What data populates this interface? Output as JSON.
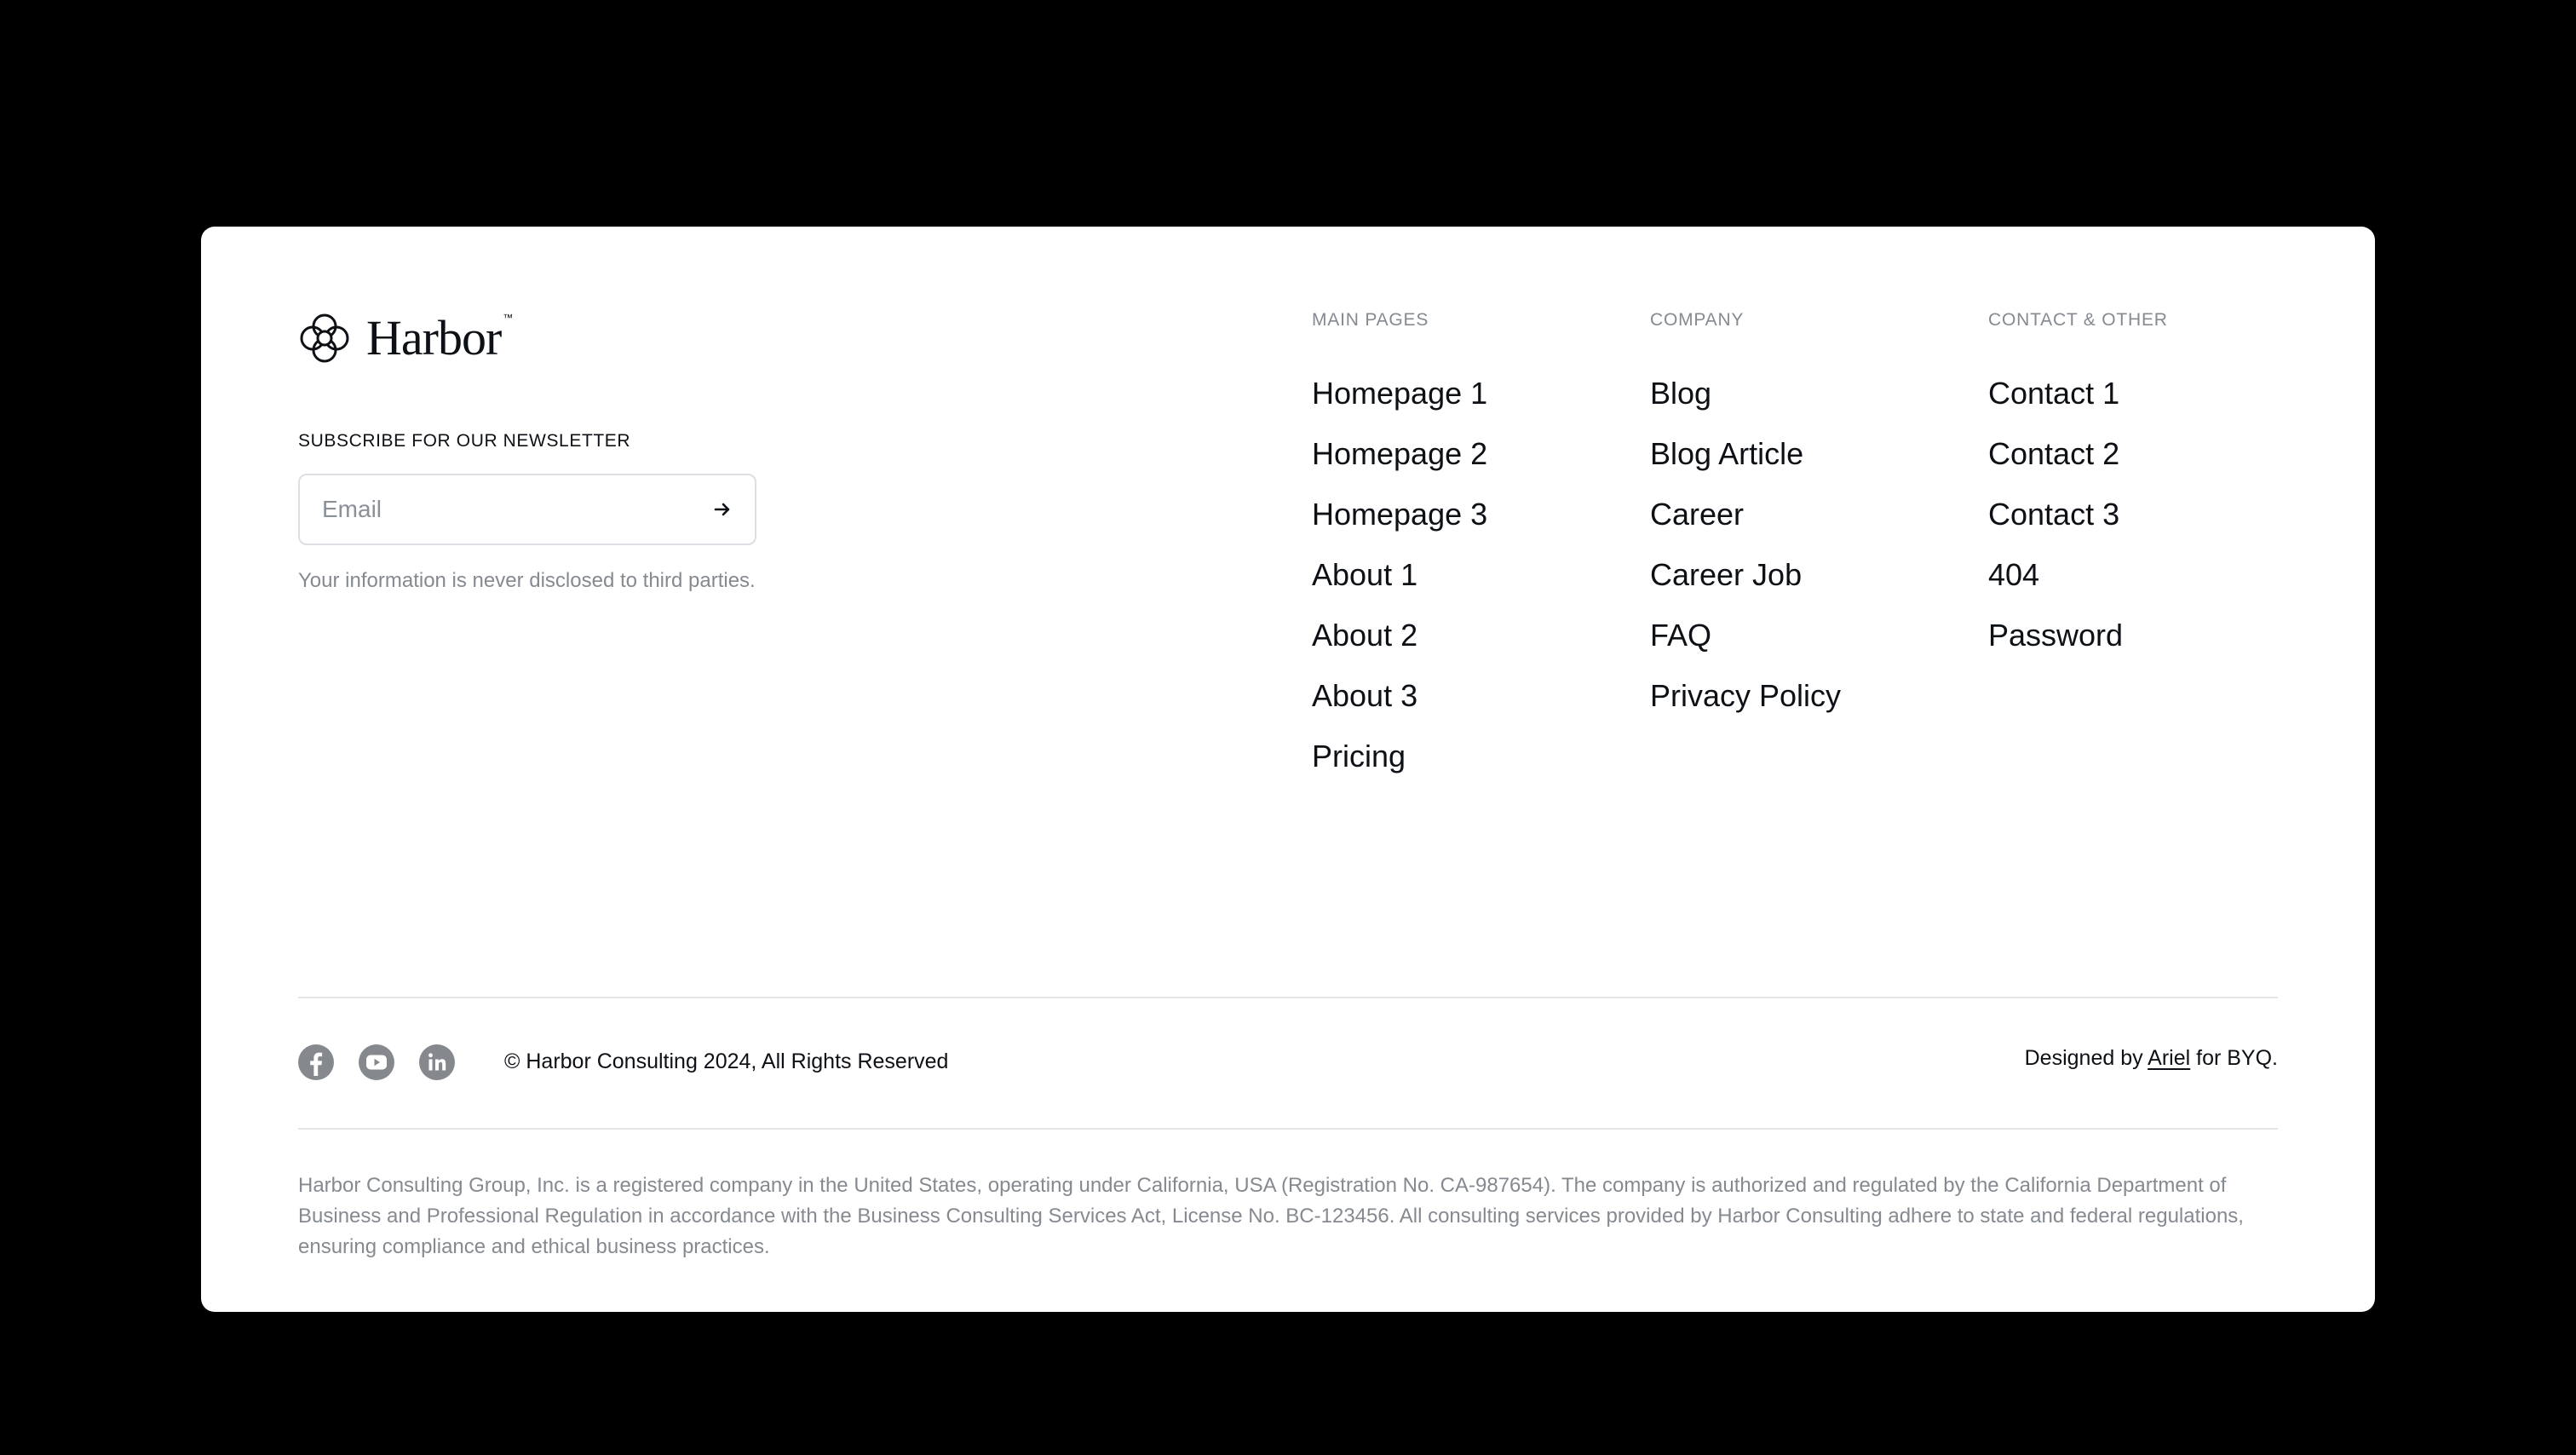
{
  "brand": {
    "name": "Harbor",
    "trademark": "™",
    "logo_icon": "four-petal-flower-icon"
  },
  "newsletter": {
    "label": "SUBSCRIBE FOR OUR NEWSLETTER",
    "email_placeholder": "Email",
    "email_value": "",
    "submit_icon": "arrow-right-icon",
    "note": "Your information is never disclosed to third parties."
  },
  "nav": {
    "main_pages": {
      "heading": "MAIN PAGES",
      "items": [
        "Homepage 1",
        "Homepage 2",
        "Homepage 3",
        "About 1",
        "About 2",
        "About 3",
        "Pricing"
      ]
    },
    "company": {
      "heading": "COMPANY",
      "items": [
        "Blog",
        "Blog Article",
        "Career",
        "Career Job",
        "FAQ",
        "Privacy Policy"
      ]
    },
    "contact_other": {
      "heading": "CONTACT & OTHER",
      "items": [
        "Contact 1",
        "Contact 2",
        "Contact 3",
        "404",
        "Password"
      ]
    }
  },
  "social": {
    "icons": [
      "facebook-icon",
      "youtube-icon",
      "linkedin-icon"
    ]
  },
  "footer": {
    "copyright": "© Harbor Consulting 2024, All Rights Reserved",
    "credit_prefix": "Designed by ",
    "credit_link": "Ariel",
    "credit_suffix": " for BYQ.",
    "legal": "Harbor Consulting Group, Inc. is a registered company in the United States, operating under California, USA (Registration No. CA-987654). The company is authorized and regulated by the California Department of Business and Professional Regulation in accordance with the Business Consulting Services Act, License No. BC-123456. All consulting services provided by Harbor Consulting adhere to state and federal regulations, ensuring compliance and ethical business practices."
  },
  "colors": {
    "background": "#000000",
    "card": "#ffffff",
    "text": "#0d1116",
    "muted": "#858a91",
    "divider": "#e4e6e9",
    "social_icon": "#85898d"
  }
}
